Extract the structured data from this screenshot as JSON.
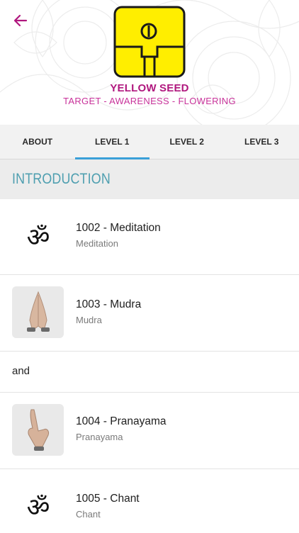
{
  "header": {
    "back_icon": "arrow-left-icon",
    "seed_icon": "yellow-seed-glyph-icon",
    "title": "YELLOW SEED",
    "subtitle": "TARGET - AWARENESS - FLOWERING",
    "colors": {
      "accent": "#b0177e",
      "seed_yellow": "#ffee00"
    }
  },
  "tabs": [
    {
      "label": "ABOUT",
      "active": false
    },
    {
      "label": "LEVEL 1",
      "active": true
    },
    {
      "label": "LEVEL 2",
      "active": false
    },
    {
      "label": "LEVEL 3",
      "active": false
    }
  ],
  "section": {
    "title": "INTRODUCTION"
  },
  "items": [
    {
      "title": "1002 - Meditation",
      "subtitle": "Meditation",
      "icon": "om-icon"
    },
    {
      "title": "1003 - Mudra",
      "subtitle": "Mudra",
      "icon": "praying-hands-photo"
    },
    {
      "separator_text": "and"
    },
    {
      "title": "1004 - Pranayama",
      "subtitle": "Pranayama",
      "icon": "hand-mudra-photo"
    },
    {
      "title": "1005 - Chant",
      "subtitle": "Chant",
      "icon": "om-icon"
    }
  ]
}
